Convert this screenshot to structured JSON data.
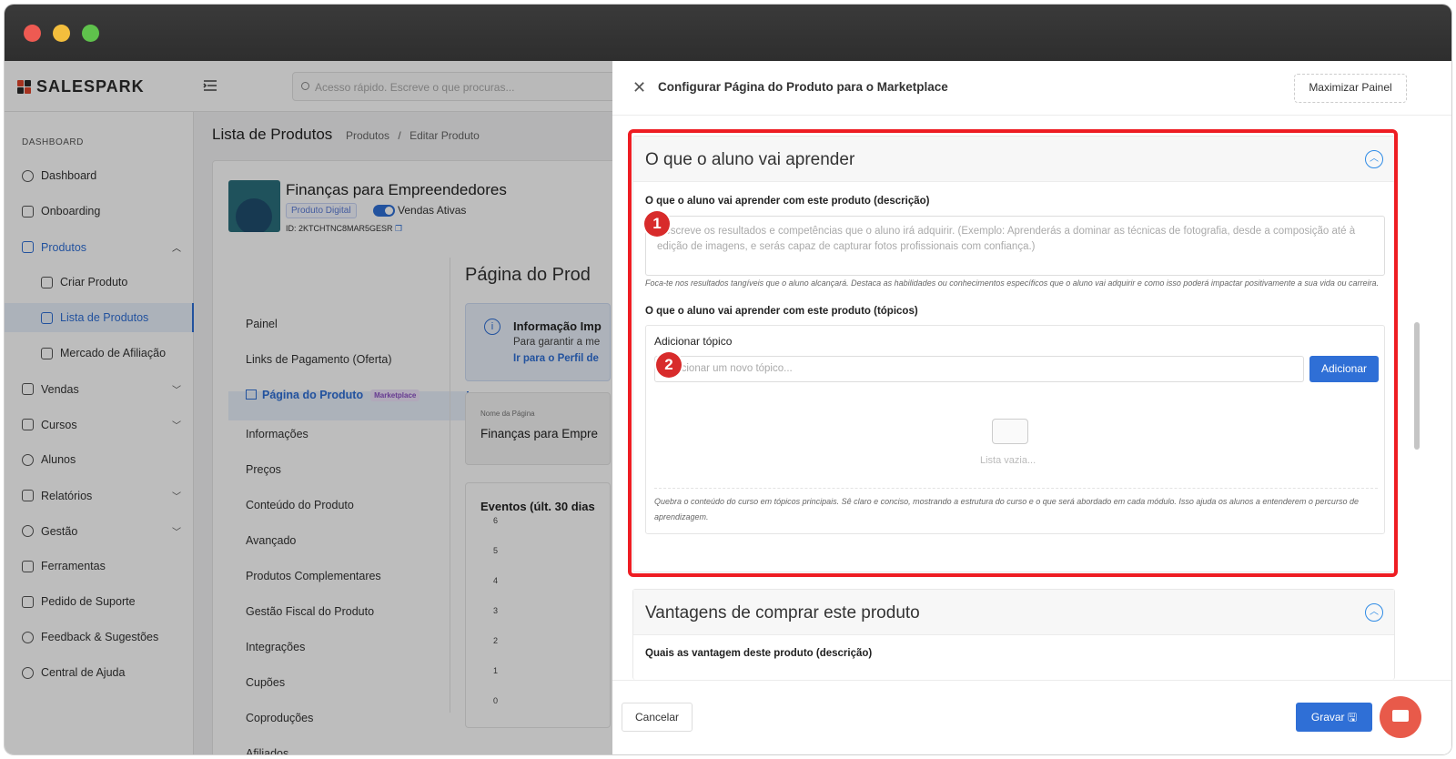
{
  "colors": {
    "accent": "#2f6fd6",
    "highlight": "#ee1d23",
    "brand": "#e0452c"
  },
  "brand": {
    "name": "SALESPARK"
  },
  "search": {
    "placeholder": "Acesso rápido. Escreve o que procuras..."
  },
  "sidebar": {
    "section": "DASHBOARD",
    "items": [
      {
        "label": "Dashboard",
        "icon": "dashboard-icon"
      },
      {
        "label": "Onboarding",
        "icon": "onboarding-icon"
      },
      {
        "label": "Produtos",
        "icon": "grid-icon"
      },
      {
        "label": "Criar Produto",
        "icon": "file-add-icon"
      },
      {
        "label": "Lista de Produtos",
        "icon": "table-icon"
      },
      {
        "label": "Mercado de Afiliação",
        "icon": "store-icon"
      },
      {
        "label": "Vendas",
        "icon": "cart-icon"
      },
      {
        "label": "Cursos",
        "icon": "monitor-icon"
      },
      {
        "label": "Alunos",
        "icon": "users-icon"
      },
      {
        "label": "Relatórios",
        "icon": "chart-icon"
      },
      {
        "label": "Gestão",
        "icon": "gear-icon"
      },
      {
        "label": "Ferramentas",
        "icon": "wrench-icon"
      },
      {
        "label": "Pedido de Suporte",
        "icon": "megaphone-icon"
      },
      {
        "label": "Feedback & Sugestões",
        "icon": "bulb-icon"
      },
      {
        "label": "Central de Ajuda",
        "icon": "help-icon"
      }
    ]
  },
  "page": {
    "title": "Lista de Produtos",
    "breadcrumb": [
      "Produtos",
      "Editar Produto"
    ],
    "breadcrumb_sep": "/"
  },
  "product": {
    "name": "Finanças para Empreendedores",
    "type_badge": "Produto Digital",
    "sales_status": "Vendas Ativas",
    "id": "ID: 2KTCHTNC8MAR5GESR"
  },
  "product_menu": [
    "Painel",
    "Links de Pagamento (Oferta)",
    "Página do Produto",
    "Informações",
    "Preços",
    "Conteúdo do Produto",
    "Avançado",
    "Produtos Complementares",
    "Gestão Fiscal do Produto",
    "Integrações",
    "Cupões",
    "Coproduções",
    "Afiliados"
  ],
  "marketplace_badge": "Marketplace",
  "page_section": {
    "title": "Página do Prod",
    "info_title": "Informação Imp",
    "info_text": "Para garantir a me",
    "info_link": "Ir para o Perfil de",
    "name_label": "Nome da Página",
    "name_value": "Finanças para Empre",
    "events_title": "Eventos (últ. 30 dias",
    "y_ticks": [
      "6",
      "5",
      "4",
      "3",
      "2",
      "1",
      "0"
    ]
  },
  "panel": {
    "title": "Configurar Página do Produto para o Marketplace",
    "maximize": "Maximizar Painel",
    "cancel": "Cancelar",
    "save": "Gravar"
  },
  "learn": {
    "title": "O que o aluno vai aprender",
    "desc_label": "O que o aluno vai aprender com este produto (descrição)",
    "desc_placeholder": "Descreve os resultados e competências que o aluno irá adquirir. (Exemplo: Aprenderás a dominar as técnicas de fotografia, desde a composição até à edição de imagens, e serás capaz de capturar fotos profissionais com confiança.)",
    "desc_hint": "Foca-te nos resultados tangíveis que o aluno alcançará. Destaca as habilidades ou conhecimentos específicos que o aluno vai adquirir e como isso poderá impactar positivamente a sua vida ou carreira.",
    "topics_label": "O que o aluno vai aprender com este produto (tópicos)",
    "add_topic_label": "Adicionar tópico",
    "topic_placeholder": "Adicionar um novo tópico...",
    "add_button": "Adicionar",
    "empty": "Lista vazia...",
    "topics_hint": "Quebra o conteúdo do curso em tópicos principais. Sê claro e conciso, mostrando a estrutura do curso e o que será abordado em cada módulo. Isso ajuda os alunos a entenderem o percurso de aprendizagem."
  },
  "advantages": {
    "title": "Vantagens de comprar este produto",
    "desc_label": "Quais as vantagem deste produto (descrição)"
  },
  "markers": [
    "1",
    "2"
  ]
}
